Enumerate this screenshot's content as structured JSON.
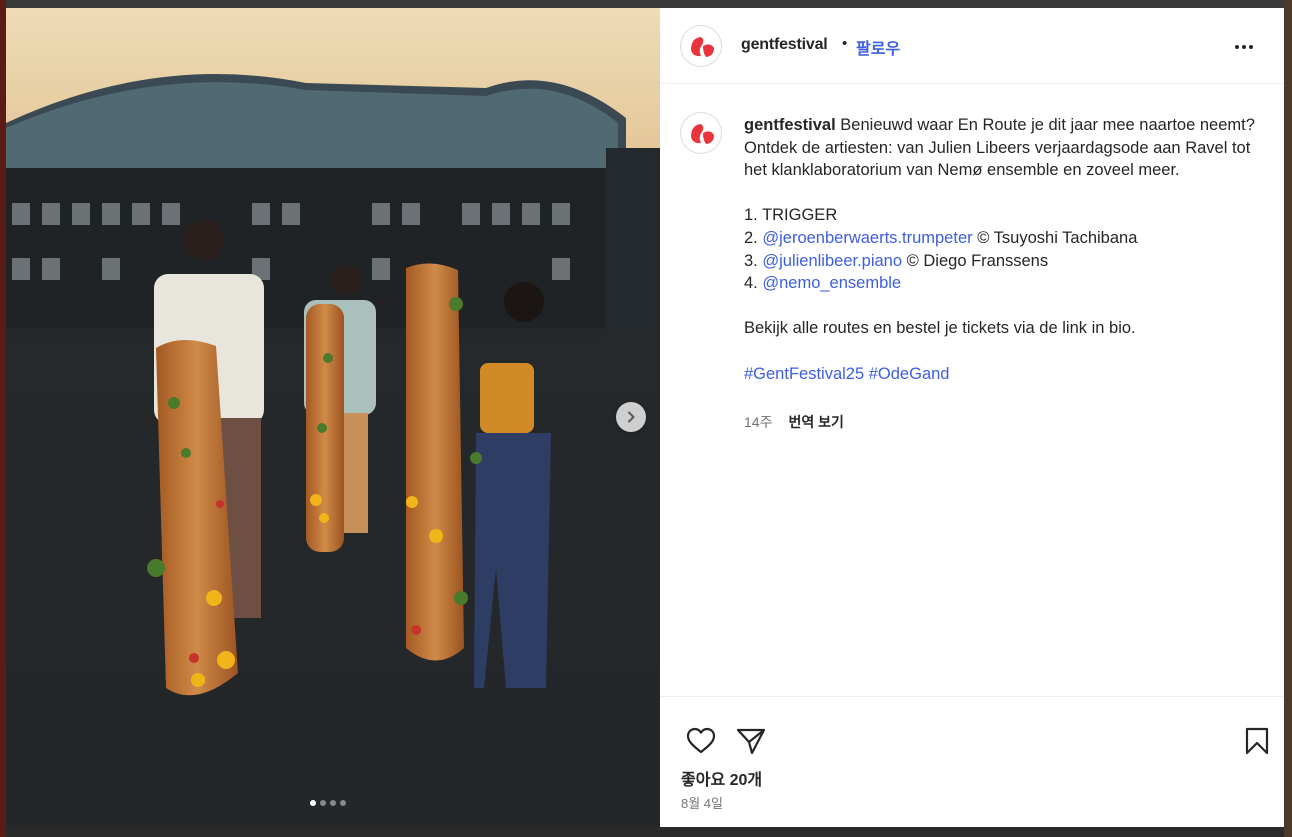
{
  "header": {
    "username": "gentfestival",
    "separator": "•",
    "follow_label": "팔로우"
  },
  "caption": {
    "username": "gentfestival",
    "intro": "Benieuwd waar En Route je dit jaar mee naartoe neemt? Ontdek de artiesten: van Julien Libeers verjaardagsode aan Ravel tot het klanklaboratorium van Nemø ensemble en zoveel meer.",
    "list": [
      {
        "num": "1.",
        "mention": "",
        "text": "TRIGGER"
      },
      {
        "num": "2.",
        "mention": "@jeroenberwaerts.trumpeter",
        "text": "© Tsuyoshi Tachibana"
      },
      {
        "num": "3.",
        "mention": "@julienlibeer.piano",
        "text": "© Diego Franssens"
      },
      {
        "num": "4.",
        "mention": "@nemo_ensemble",
        "text": ""
      }
    ],
    "outro": "Bekijk alle routes en bestel je tickets via de link in bio.",
    "hashtags": [
      "#GentFestival25",
      "#OdeGand"
    ],
    "age": "14주",
    "translate_label": "번역 보기"
  },
  "footer": {
    "likes": "좋아요 20개",
    "date": "8월 4일"
  },
  "carousel": {
    "slide_count": 4,
    "active_index": 0
  },
  "icons": {
    "like": "heart-icon",
    "share": "paper-plane-icon",
    "save": "bookmark-icon",
    "more": "more-icon",
    "next": "chevron-right-icon"
  },
  "colors": {
    "link": "#3d5ee1",
    "brand": "#e8343a"
  }
}
